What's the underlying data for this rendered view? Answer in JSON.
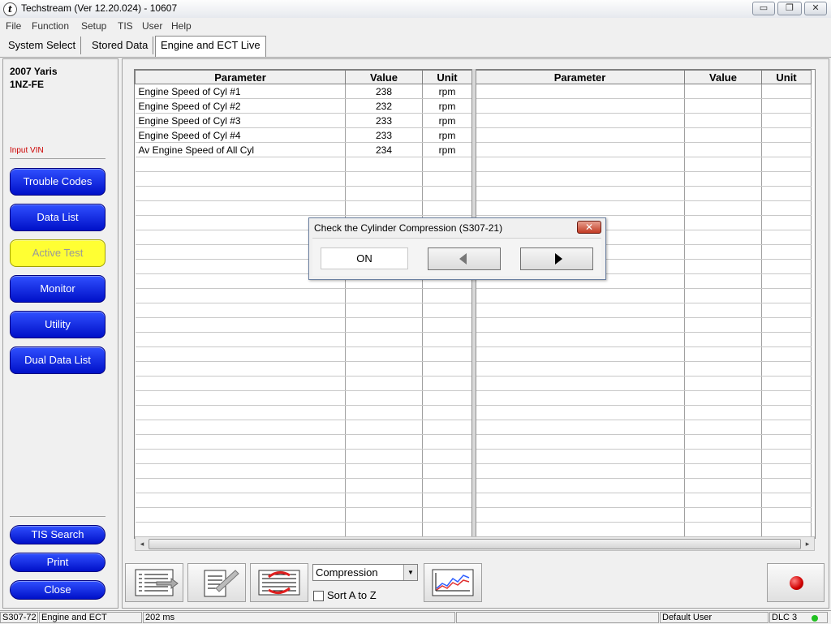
{
  "window": {
    "title": "Techstream (Ver 12.20.024) - 10607",
    "app_icon_glyph": "t",
    "controls": {
      "minimize": "▭",
      "maximize": "❐",
      "close": "✕"
    }
  },
  "menu": [
    "File",
    "Function",
    "Setup",
    "TIS",
    "User",
    "Help"
  ],
  "tabs": [
    {
      "label": "System Select",
      "active": false
    },
    {
      "label": "Stored Data",
      "active": false
    },
    {
      "label": "Engine and ECT Live",
      "active": true
    }
  ],
  "sidebar": {
    "vehicle_model": "2007 Yaris",
    "vehicle_engine": "1NZ-FE",
    "input_vin": "Input VIN",
    "buttons": [
      "Trouble Codes",
      "Data List",
      "Active Test",
      "Monitor",
      "Utility",
      "Dual Data List"
    ],
    "bottom_buttons": [
      "TIS Search",
      "Print",
      "Close"
    ]
  },
  "grid": {
    "headers": [
      "Parameter",
      "Value",
      "Unit"
    ],
    "rows": [
      {
        "parameter": "Engine Speed of Cyl #1",
        "value": "238",
        "unit": "rpm"
      },
      {
        "parameter": "Engine Speed of Cyl #2",
        "value": "232",
        "unit": "rpm"
      },
      {
        "parameter": "Engine Speed of Cyl #3",
        "value": "233",
        "unit": "rpm"
      },
      {
        "parameter": "Engine Speed of Cyl #4",
        "value": "233",
        "unit": "rpm"
      },
      {
        "parameter": "Av Engine Speed of All Cyl",
        "value": "234",
        "unit": "rpm"
      }
    ]
  },
  "dialog": {
    "title": "Check the Cylinder Compression (S307-21)",
    "state": "ON",
    "close_glyph": "✕"
  },
  "toolbar": {
    "group_select": "Compression",
    "sort_label": "Sort A to Z",
    "sort_checked": false
  },
  "statusbar": {
    "code": "S307-72",
    "system": "Engine and ECT",
    "interval": "202 ms",
    "user": "Default User",
    "dlc": "DLC 3",
    "dlc_color": "#20c020"
  },
  "colors": {
    "nav_button": "#0010c8",
    "active_test_button": "#ffff33",
    "vin_label": "#cc0000",
    "record": "#d00000"
  }
}
